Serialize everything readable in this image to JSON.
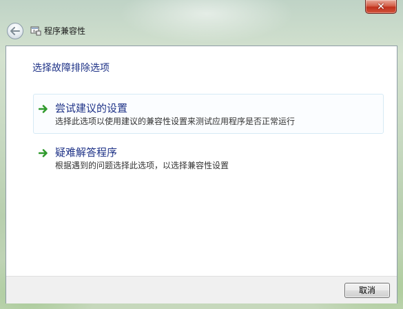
{
  "window": {
    "title": "程序兼容性",
    "close_label": "✕",
    "back_icon": "back-arrow-icon",
    "app_icon": "compatibility-icon"
  },
  "main": {
    "heading": "选择故障排除选项",
    "options": [
      {
        "title": "尝试建议的设置",
        "description": "选择此选项以使用建议的兼容性设置来测试应用程序是否正常运行",
        "icon": "green-arrow-icon"
      },
      {
        "title": "疑难解答程序",
        "description": "根据遇到的问题选择此选项，以选择兼容性设置",
        "icon": "green-arrow-icon"
      }
    ]
  },
  "footer": {
    "cancel_label": "取消"
  },
  "colors": {
    "link_blue": "#1e3287",
    "arrow_green": "#2f9a2c",
    "close_red": "#c0311d"
  }
}
